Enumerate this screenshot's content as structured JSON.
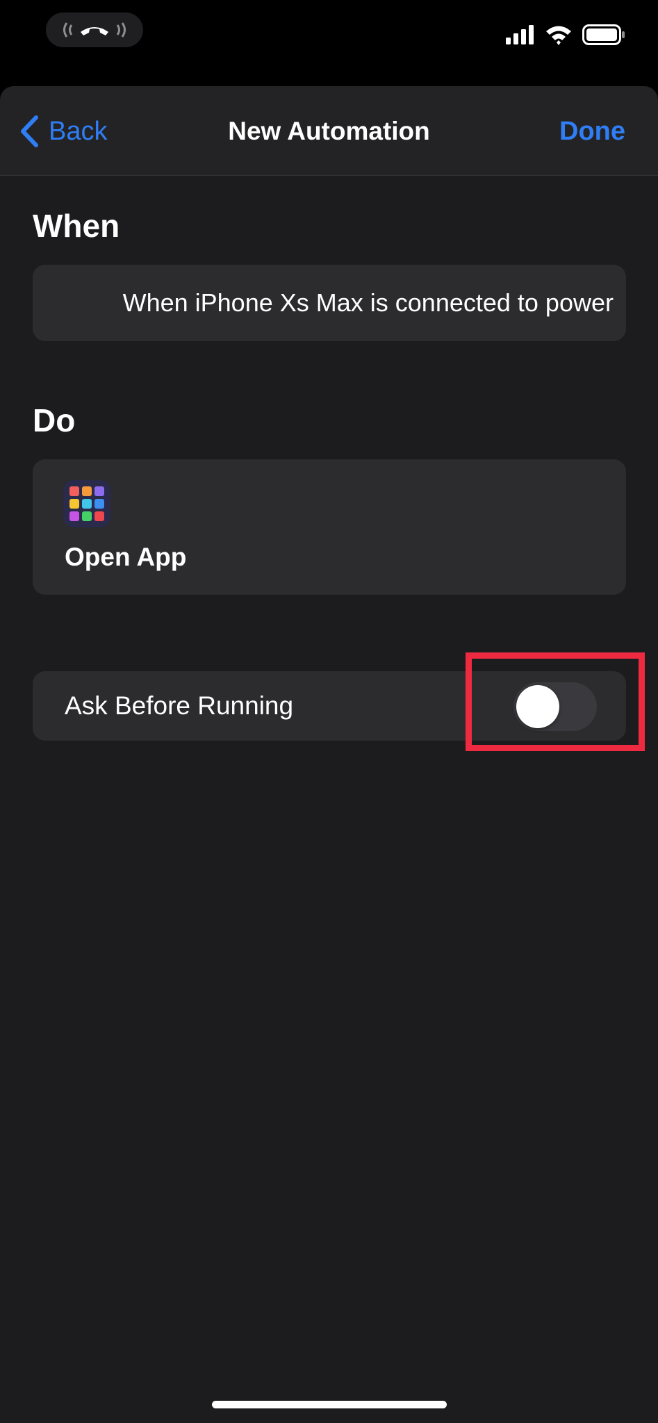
{
  "status_bar": {
    "call_icon": "phone-ringing-icon",
    "signal_icon": "cellular-signal-icon",
    "wifi_icon": "wifi-icon",
    "battery_icon": "battery-icon"
  },
  "nav": {
    "back_label": "Back",
    "title": "New Automation",
    "done_label": "Done"
  },
  "when": {
    "heading": "When",
    "trigger_text": "When iPhone Xs Max is connected to power"
  },
  "do": {
    "heading": "Do",
    "action_icon": "app-grid-icon",
    "action_label": "Open App"
  },
  "options": {
    "ask_before_running_label": "Ask Before Running",
    "ask_before_running_enabled": false
  },
  "colors": {
    "accent": "#2f7ef5",
    "background": "#1c1c1e",
    "card": "#2c2c2e",
    "highlight": "#ee2a40"
  }
}
